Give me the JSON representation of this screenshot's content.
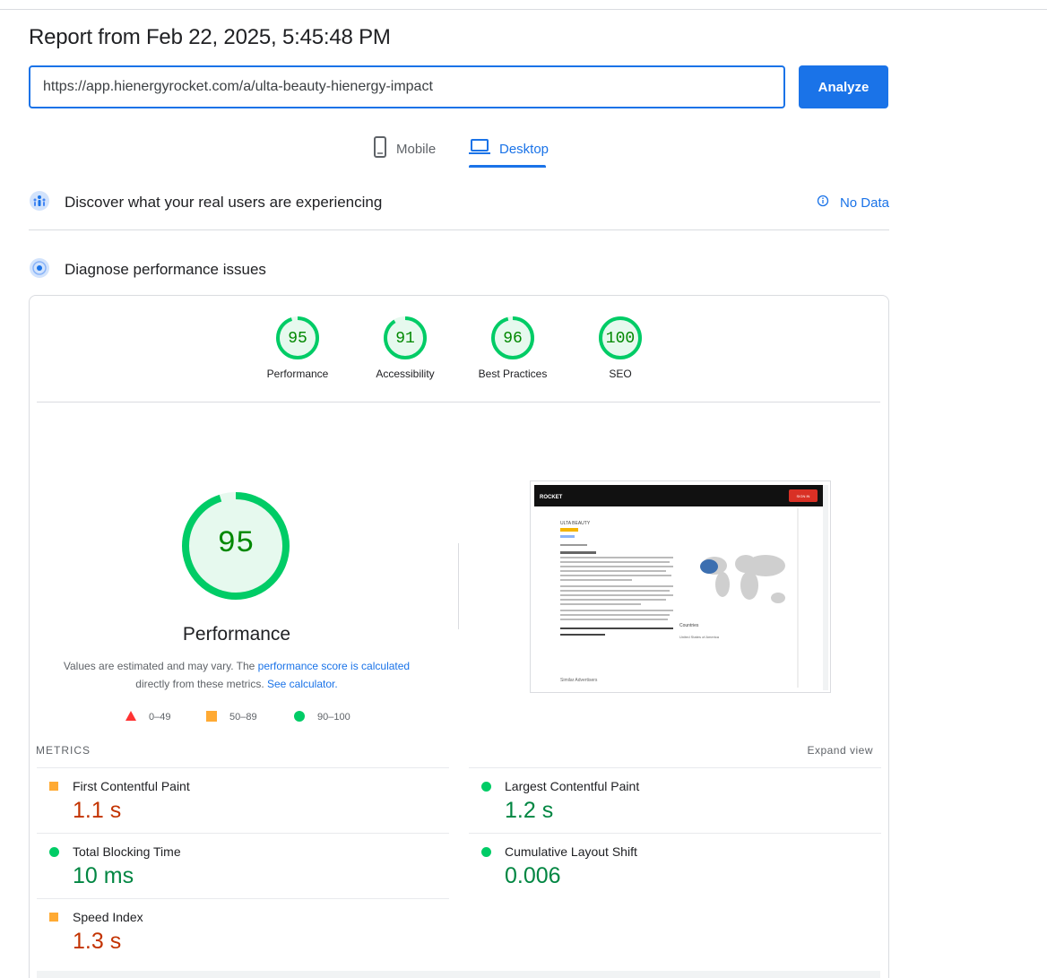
{
  "report": {
    "title": "Report from Feb 22, 2025, 5:45:48 PM",
    "url_value": "https://app.hienergyrocket.com/a/ulta-beauty-hienergy-impact",
    "analyze_label": "Analyze"
  },
  "tabs": [
    {
      "label": "Mobile",
      "icon": "phone-icon",
      "selected": false
    },
    {
      "label": "Desktop",
      "icon": "laptop-icon",
      "selected": true
    }
  ],
  "crux": {
    "label": "Discover what your real users are experiencing",
    "no_data_label": "No Data"
  },
  "diagnose": {
    "label": "Diagnose performance issues"
  },
  "categories": [
    {
      "name": "Performance",
      "score": "95",
      "fraction": 0.95
    },
    {
      "name": "Accessibility",
      "score": "91",
      "fraction": 0.91
    },
    {
      "name": "Best Practices",
      "score": "96",
      "fraction": 0.96
    },
    {
      "name": "SEO",
      "score": "100",
      "fraction": 1.0
    }
  ],
  "performance": {
    "score": "95",
    "fraction": 0.95,
    "title": "Performance",
    "desc_prefix": "Values are estimated and may vary. The ",
    "desc_link1": "performance score is calculated",
    "desc_middle": " directly from these metrics. ",
    "desc_link2": "See calculator."
  },
  "legend": [
    {
      "range": "0–49",
      "shape": "triangle",
      "color": "#ff3333"
    },
    {
      "range": "50–89",
      "shape": "square",
      "color": "#ffaa33"
    },
    {
      "range": "90–100",
      "shape": "circle",
      "color": "#00cc66"
    }
  ],
  "thumbnail": {
    "sign_in": "SIGN IN",
    "heading": "ULTA BEAUTY",
    "countries_label": "Countries",
    "country": "United States of America",
    "similar": "Similar Advertisers"
  },
  "metrics": {
    "header": "METRICS",
    "expand_label": "Expand view",
    "items": [
      {
        "label": "First Contentful Paint",
        "value": "1.1 s",
        "rating": "average"
      },
      {
        "label": "Largest Contentful Paint",
        "value": "1.2 s",
        "rating": "pass"
      },
      {
        "label": "Total Blocking Time",
        "value": "10 ms",
        "rating": "pass"
      },
      {
        "label": "Cumulative Layout Shift",
        "value": "0.006",
        "rating": "pass"
      },
      {
        "label": "Speed Index",
        "value": "1.3 s",
        "rating": "average"
      }
    ]
  },
  "colors": {
    "accent": "#1a73e8",
    "pass": "#0c6",
    "average": "#ffaa33",
    "fail": "#ff3333"
  }
}
